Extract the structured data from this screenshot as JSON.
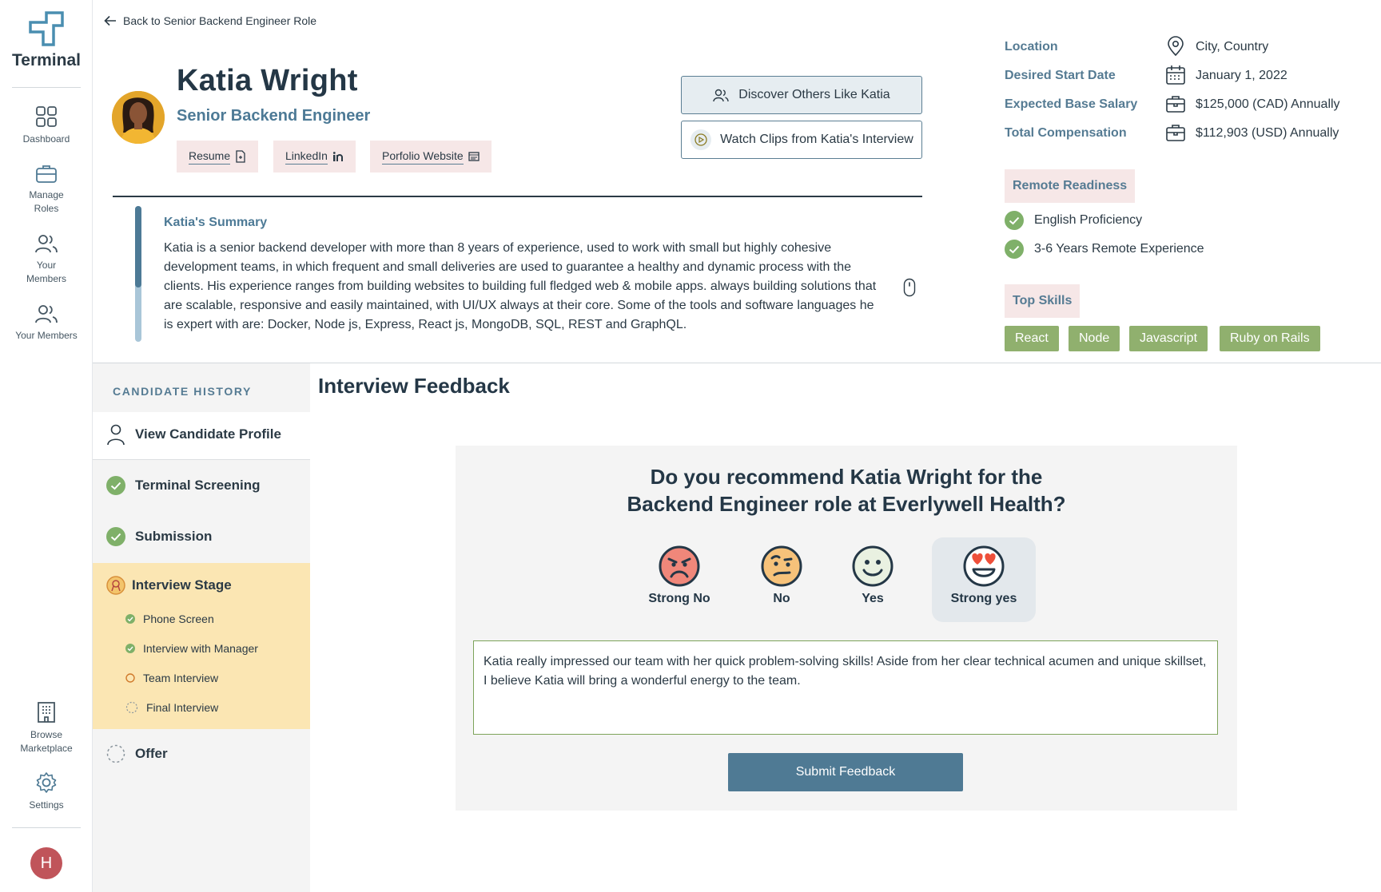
{
  "app": {
    "brand": "Terminal"
  },
  "nav": {
    "items": [
      {
        "label": "Dashboard",
        "icon": "grid-icon"
      },
      {
        "label": "Manage Roles",
        "icon": "briefcase-icon"
      },
      {
        "label": "Your Members",
        "icon": "users-icon"
      },
      {
        "label": "Your Members",
        "icon": "users-icon"
      }
    ],
    "bottom": [
      {
        "label": "Browse Marketplace",
        "icon": "building-icon"
      },
      {
        "label": "Settings",
        "icon": "gear-icon"
      }
    ],
    "avatar_initial": "H"
  },
  "header": {
    "back_link": "Back to Senior Backend Engineer Role",
    "name": "Katia Wright",
    "role": "Senior Backend Engineer",
    "links": [
      "Resume",
      "LinkedIn",
      "Porfolio Website"
    ],
    "discover_button": "Discover Others Like Katia",
    "clips_button": "Watch Clips from Katia's Interview"
  },
  "summary": {
    "title": "Katia's Summary",
    "text": "Katia is a senior backend developer with more than 8 years of experience, used to work with small but highly cohesive development teams, in which frequent and small deliveries are used to guarantee a healthy and dynamic process with the clients. His experience ranges from building websites to building full fledged web & mobile apps. always building solutions that are scalable, responsive and easily maintained, with UI/UX always at their core. Some of the tools and software languages he is expert with are: Docker, Node js, Express, React js, MongoDB, SQL, REST and GraphQL."
  },
  "details": {
    "location_label": "Location",
    "location_value": "City, Country",
    "start_label": "Desired Start Date",
    "start_value": "January 1, 2022",
    "salary_label": "Expected Base Salary",
    "salary_value": "$125,000 (CAD) Annually",
    "comp_label": "Total Compensation",
    "comp_value": "$112,903 (USD) Annually"
  },
  "remote": {
    "title": "Remote Readiness",
    "items": [
      "English Proficiency",
      "3-6 Years Remote Experience"
    ]
  },
  "skills": {
    "title": "Top Skills",
    "items": [
      "React",
      "Node",
      "Javascript",
      "Ruby on Rails"
    ]
  },
  "history": {
    "title": "CANDIDATE HISTORY",
    "profile": "View Candidate Profile",
    "screening": "Terminal Screening",
    "submission": "Submission",
    "stage": "Interview Stage",
    "substeps": [
      "Phone Screen",
      "Interview with Manager",
      "Team Interview",
      "Final Interview"
    ],
    "offer": "Offer"
  },
  "feedback": {
    "title": "Interview Feedback",
    "question_line1": "Do you recommend Katia Wright for the",
    "question_line2": "Backend Engineer role at Everlywell Health?",
    "ratings": [
      "Strong No",
      "No",
      "Yes",
      "Strong yes"
    ],
    "selected": "Strong yes",
    "comment": "Katia really impressed our team with her quick problem-solving skills! Aside from her clear technical acumen and unique skillset, I believe Katia will bring a wonderful energy to the team.",
    "submit": "Submit Feedback"
  },
  "colors": {
    "accent": "#4f7a94",
    "success": "#7fb069",
    "stage_highlight": "#fbe6b3",
    "chip": "#f6e7e7",
    "skill": "#90b06e"
  }
}
